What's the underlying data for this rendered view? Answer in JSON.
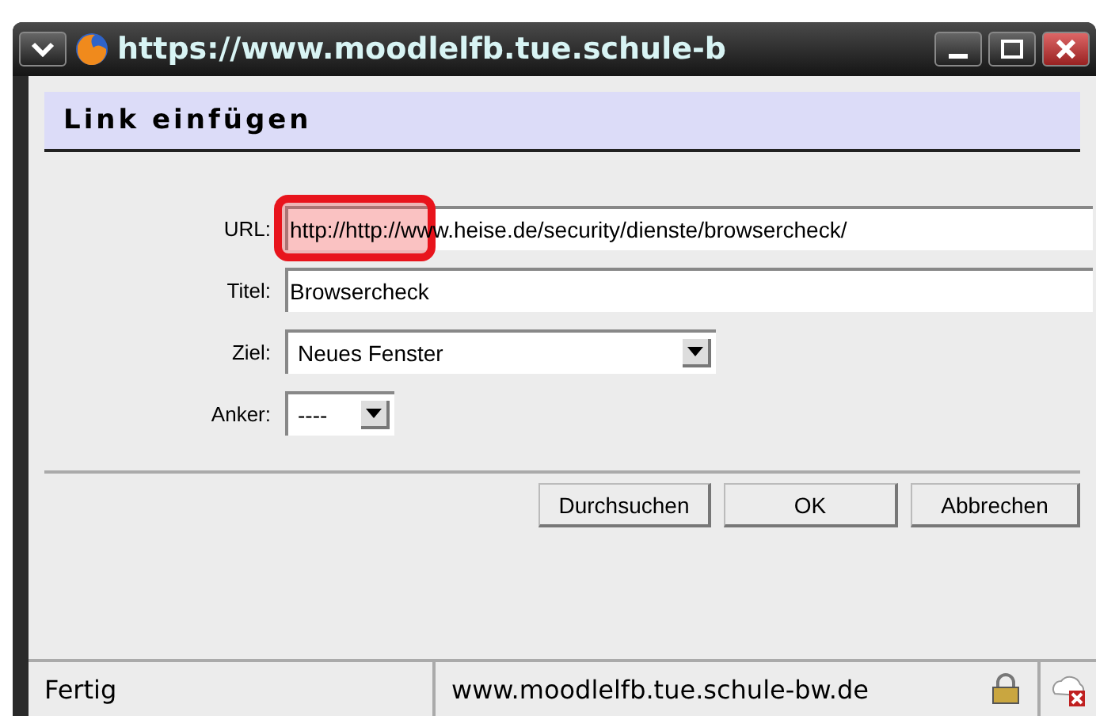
{
  "window": {
    "title": "https://www.moodlelfb.tue.schule-b"
  },
  "dialog": {
    "title": "Link einfügen"
  },
  "fields": [
    {
      "kind": "text",
      "label": "URL:",
      "value": "http://http://www.heise.de/security/dienste/browsercheck/",
      "highlighted": true
    },
    {
      "kind": "text",
      "label": "Titel:",
      "value": "Browsercheck",
      "highlighted": false
    },
    {
      "kind": "select",
      "label": "Ziel:",
      "value": "Neues Fenster",
      "highlighted": false
    },
    {
      "kind": "select",
      "label": "Anker:",
      "value": "----",
      "highlighted": false
    }
  ],
  "buttons": [
    "Durchsuchen",
    "OK",
    "Abbrechen"
  ],
  "status_bar": {
    "status": "Fertig",
    "domain": "www.moodlelfb.tue.schule-bw.de"
  }
}
